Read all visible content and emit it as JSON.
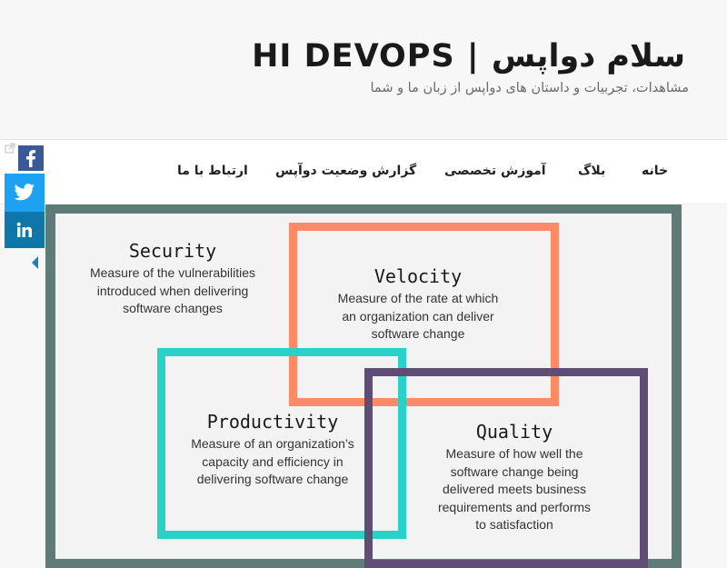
{
  "site": {
    "title": "HI DEVOPS | سلام دواپس",
    "description": "مشاهدات، تجربیات و داستان های دواپس از زبان ما و شما"
  },
  "nav": {
    "items": [
      {
        "label": "خانه"
      },
      {
        "label": "بلاگ"
      },
      {
        "label": "آموزش تخصصی"
      },
      {
        "label": "گزارش وضعیت دوآپس"
      },
      {
        "label": "ارتباط با ما"
      }
    ]
  },
  "share": {
    "facebook_icon": "facebook-icon",
    "twitter_icon": "twitter-icon",
    "linkedin_icon": "linkedin-icon",
    "colors": {
      "facebook": "#3b5998",
      "twitter": "#1da1f2",
      "linkedin": "#0e76a8"
    }
  },
  "diagram": {
    "security": {
      "heading": "Security",
      "lines": [
        "Measure of the vulnerabilities",
        "introduced when delivering",
        "software changes"
      ]
    },
    "velocity": {
      "heading": "Velocity",
      "lines": [
        "Measure of the rate at which",
        "an organization can deliver",
        "software change"
      ],
      "color": "#ff8a66"
    },
    "productivity": {
      "heading": "Productivity",
      "lines": [
        "Measure of an organization’s",
        "capacity and efficiency in",
        "delivering software change"
      ],
      "color": "#29d1c9"
    },
    "quality": {
      "heading": "Quality",
      "lines": [
        "Measure of how well the",
        "software change being",
        "delivered meets business",
        "requirements and performs",
        "to satisfaction"
      ],
      "color": "#604d75"
    },
    "frame_color": "#5f7b78"
  }
}
